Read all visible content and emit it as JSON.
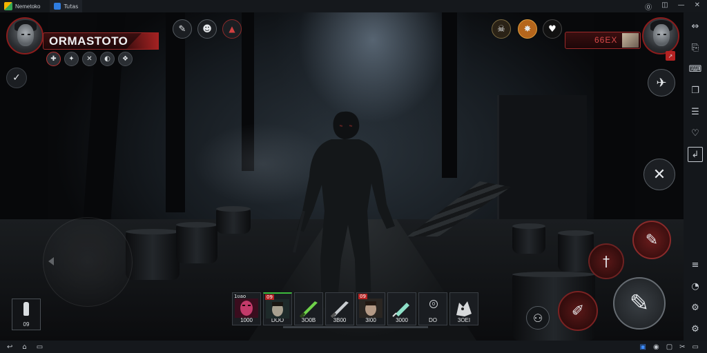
{
  "emulator": {
    "app_name": "Nemetoko",
    "tab_label": "Tutas",
    "sidebar_icons": [
      "expand-icon",
      "screenshot-icon",
      "keymap-icon",
      "multi-instance-icon",
      "record-icon",
      "shake-icon",
      "import-icon",
      "layers-icon",
      "rotate-icon",
      "settings-icon",
      "info-icon"
    ],
    "window_controls": [
      "help-icon",
      "restore-icon",
      "minimize-icon",
      "close-icon"
    ]
  },
  "player": {
    "name": "ORMASTOTO",
    "status_icons": [
      "bleed-icon",
      "plus-icon",
      "cross-icon",
      "moon-icon",
      "paw-icon"
    ]
  },
  "top_center_icons": [
    "syringe-icon",
    "mask-icon",
    "bell-icon"
  ],
  "target": {
    "name": "66EX",
    "top_icons": [
      "skull-icon",
      "burst-icon",
      "heart-icon"
    ]
  },
  "left_item": {
    "count": "09"
  },
  "hotbar": [
    {
      "top": "1ʋao",
      "count": "1000",
      "kind": "zombie-portrait"
    },
    {
      "top": "09",
      "top_red": true,
      "count": "DOO",
      "kind": "man-portrait"
    },
    {
      "top": "",
      "count": "3O0B",
      "kind": "green-knife"
    },
    {
      "top": "",
      "count": "3B00",
      "kind": "silver-knife"
    },
    {
      "top": "09",
      "top_red": true,
      "count": "3I00",
      "kind": "man-portrait-2"
    },
    {
      "top": "",
      "count": "3000",
      "kind": "syringe"
    },
    {
      "top": "0",
      "circle": true,
      "count": "DO",
      "kind": "empty"
    },
    {
      "top": "",
      "count": "3OEI",
      "kind": "wolf-mask"
    }
  ],
  "colors": {
    "accent_red": "#9c2a2a",
    "bar_blue": "#3d8bff"
  }
}
